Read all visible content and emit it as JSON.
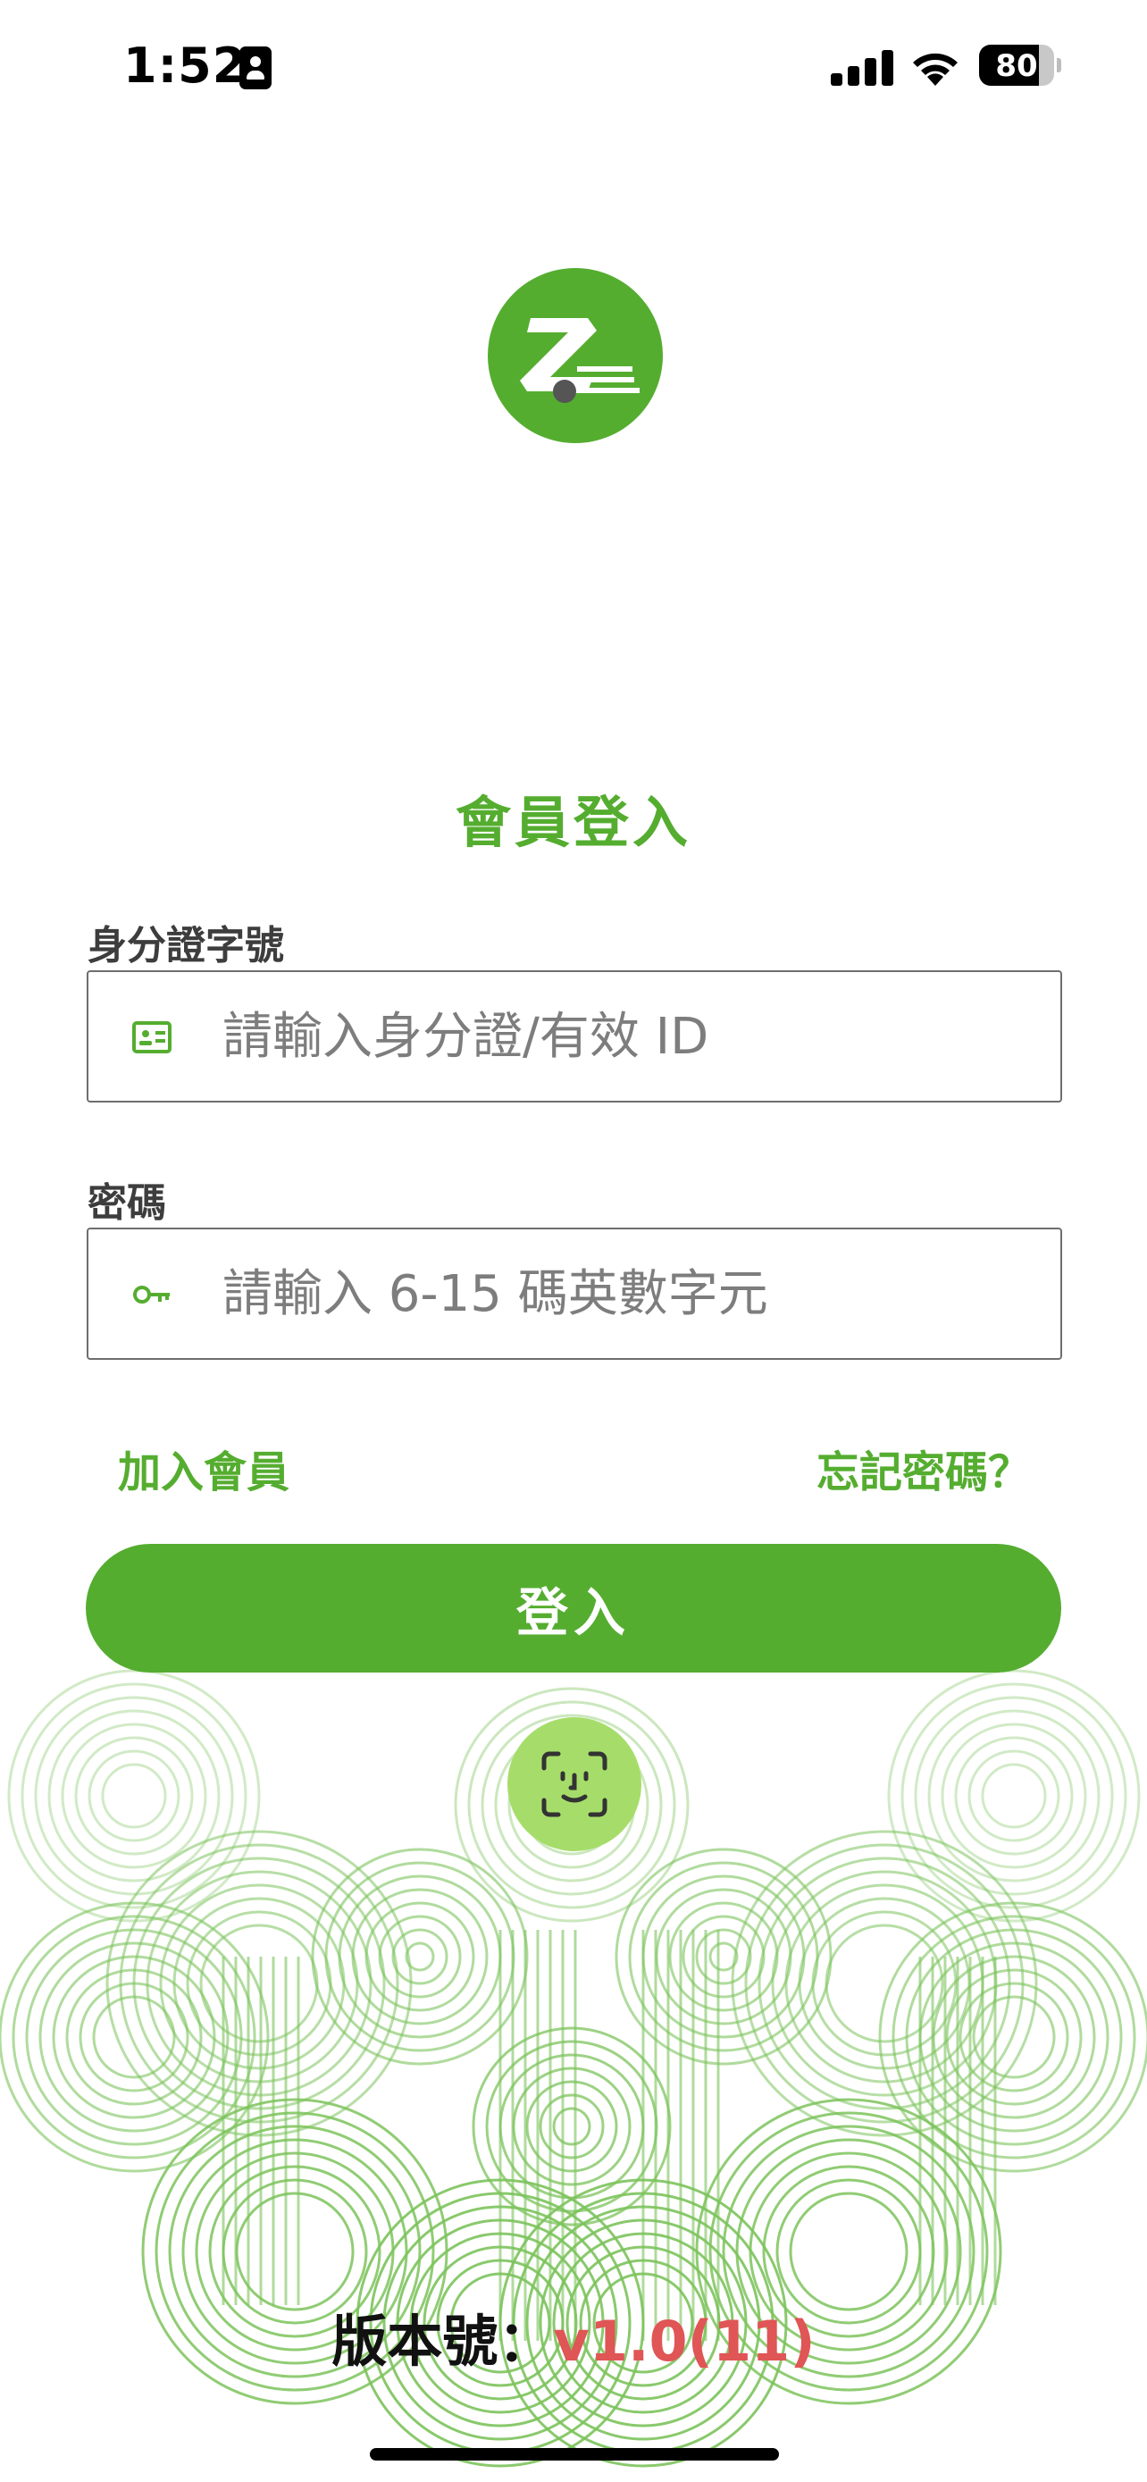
{
  "status_bar": {
    "time": "1:52",
    "battery_level": "80",
    "battery_fraction": 0.8
  },
  "logo": {
    "name": "z-logo-icon",
    "letter": "Z",
    "color": "#55ad30"
  },
  "title": "會員登入",
  "id_field": {
    "label": "身分證字號",
    "placeholder": "請輸入身分證/有效 ID",
    "icon": "id-card-icon"
  },
  "password_field": {
    "label": "密碼",
    "placeholder": "請輸入 6-15 碼英數字元",
    "icon": "key-icon"
  },
  "links": {
    "join": "加入會員",
    "forgot": "忘記密碼？"
  },
  "login_button": "登入",
  "faceid": {
    "icon": "face-id-icon",
    "color": "#a6dd6a"
  },
  "version": {
    "label": "版本號：",
    "value": "v1.0(11)"
  },
  "colors": {
    "primary": "#55ad30",
    "faceid": "#a6dd6a",
    "version_value": "#e05555"
  }
}
